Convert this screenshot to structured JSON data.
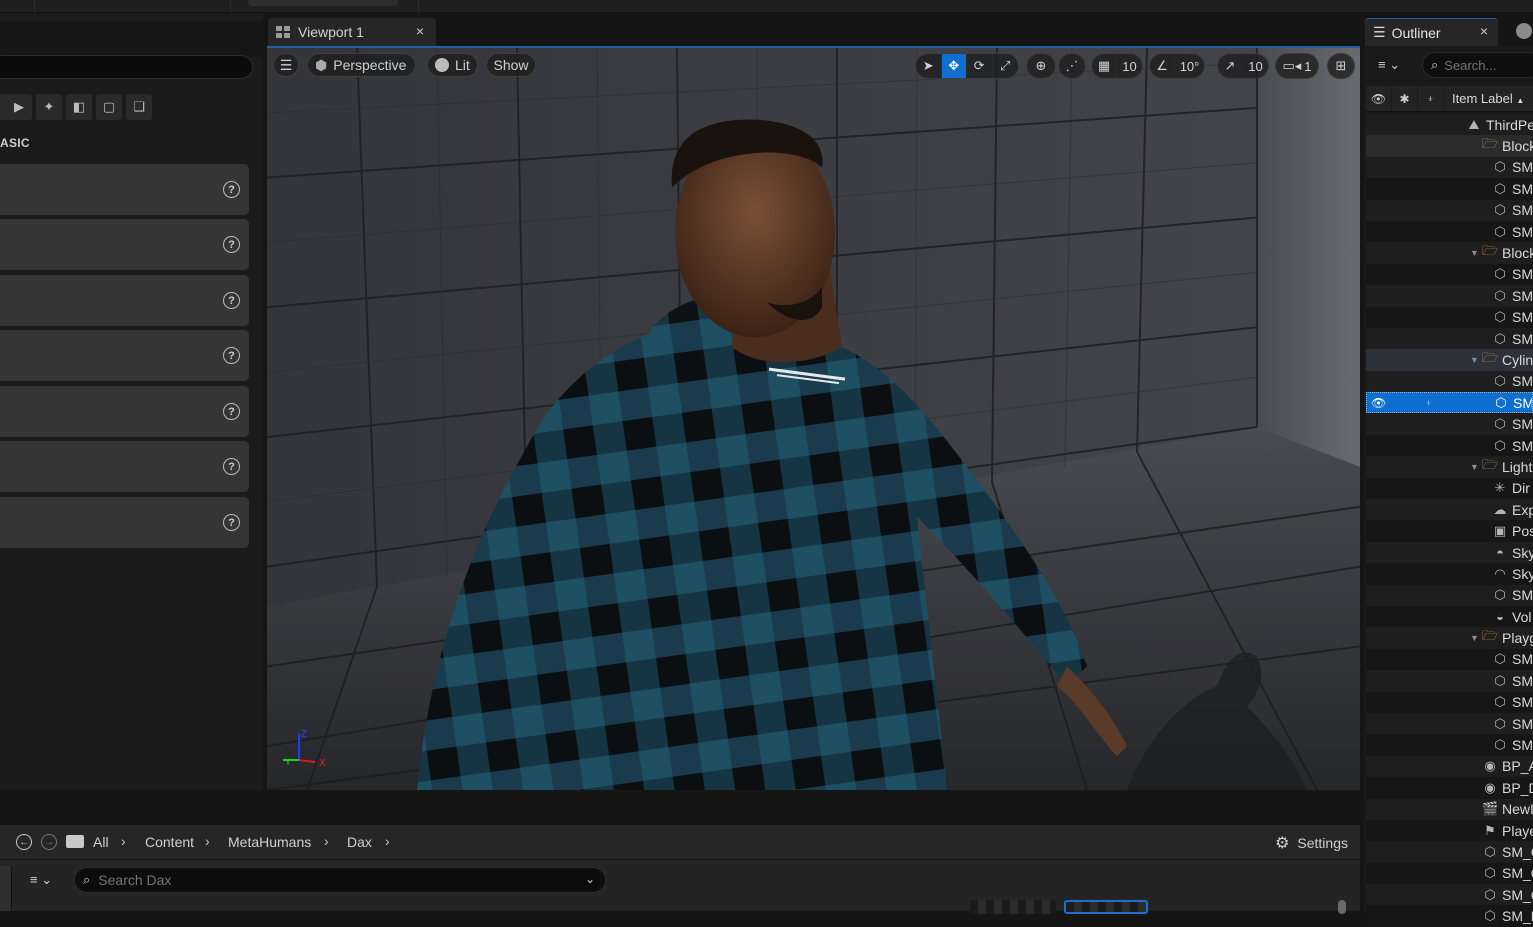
{
  "viewport_tab": {
    "label": "Viewport 1",
    "close": "×"
  },
  "viewport_toolbar": {
    "menu_icon": "hamburger-icon",
    "perspective_label": "Perspective",
    "lit_label": "Lit",
    "show_label": "Show",
    "tools": [
      "select",
      "translate",
      "rotate",
      "scale"
    ],
    "active_tool": "translate",
    "grid_snap_value": "10",
    "rotation_snap_value": "10°",
    "scale_snap_value": "10",
    "camera_speed_value": "1"
  },
  "left_panel": {
    "category_label": "ASIC",
    "place_items_count": 7,
    "mode_icons": [
      "play-icon",
      "sparkle-icon",
      "shapes-icon",
      "square-icon",
      "stack-icon"
    ]
  },
  "axis_gizmo": {
    "x": "X",
    "y": "Y",
    "z": "Z"
  },
  "outliner": {
    "tab_label": "Outliner",
    "close": "×",
    "search_placeholder": "Search...",
    "column_label": "Item Label",
    "sort_indicator": "▲",
    "rows": [
      {
        "label": "ThirdPe",
        "icon": "level-icon",
        "indent": 1
      },
      {
        "label": "Block",
        "icon": "folder-icon",
        "indent": 2,
        "folder": true
      },
      {
        "label": "SM",
        "icon": "mesh-icon",
        "indent": 3
      },
      {
        "label": "SM",
        "icon": "mesh-icon",
        "indent": 3
      },
      {
        "label": "SM",
        "icon": "mesh-icon",
        "indent": 3
      },
      {
        "label": "SM",
        "icon": "mesh-icon",
        "indent": 3
      },
      {
        "label": "Block",
        "icon": "folder-icon",
        "indent": 2,
        "folder": true,
        "expanded": true
      },
      {
        "label": "SM",
        "icon": "mesh-icon",
        "indent": 3
      },
      {
        "label": "SM",
        "icon": "mesh-icon",
        "indent": 3
      },
      {
        "label": "SM",
        "icon": "mesh-icon",
        "indent": 3
      },
      {
        "label": "SM",
        "icon": "mesh-icon",
        "indent": 3
      },
      {
        "label": "Cylin",
        "icon": "folder-icon",
        "indent": 2,
        "folder": true,
        "expanded": true,
        "hover": true
      },
      {
        "label": "SM",
        "icon": "mesh-icon",
        "indent": 3
      },
      {
        "label": "SM",
        "icon": "mesh-icon",
        "indent": 3,
        "selected": true
      },
      {
        "label": "SM",
        "icon": "mesh-icon",
        "indent": 3
      },
      {
        "label": "SM",
        "icon": "mesh-icon",
        "indent": 3
      },
      {
        "label": "Light",
        "icon": "folder-icon",
        "indent": 2,
        "folder": true,
        "expanded": true
      },
      {
        "label": "Dir",
        "icon": "directional-light-icon",
        "indent": 3
      },
      {
        "label": "Exp",
        "icon": "fog-icon",
        "indent": 3
      },
      {
        "label": "Pos",
        "icon": "post-process-icon",
        "indent": 3
      },
      {
        "label": "Sky",
        "icon": "sky-atmosphere-icon",
        "indent": 3
      },
      {
        "label": "Sky",
        "icon": "sky-light-icon",
        "indent": 3
      },
      {
        "label": "SM",
        "icon": "mesh-icon",
        "indent": 3
      },
      {
        "label": "Vol",
        "icon": "volumetric-cloud-icon",
        "indent": 3
      },
      {
        "label": "Playg",
        "icon": "folder-icon",
        "indent": 2,
        "folder": true,
        "expanded": true
      },
      {
        "label": "SM",
        "icon": "mesh-icon",
        "indent": 3
      },
      {
        "label": "SM",
        "icon": "mesh-icon",
        "indent": 3
      },
      {
        "label": "SM",
        "icon": "mesh-icon",
        "indent": 3
      },
      {
        "label": "SM",
        "icon": "mesh-icon",
        "indent": 3
      },
      {
        "label": "SM",
        "icon": "mesh-icon",
        "indent": 3
      },
      {
        "label": "BP_A",
        "icon": "blueprint-actor-icon",
        "indent": 2
      },
      {
        "label": "BP_D",
        "icon": "blueprint-actor-icon",
        "indent": 2
      },
      {
        "label": "NewI",
        "icon": "level-sequence-icon",
        "indent": 2
      },
      {
        "label": "Playe",
        "icon": "player-start-icon",
        "indent": 2
      },
      {
        "label": "SM_C",
        "icon": "mesh-icon",
        "indent": 2
      },
      {
        "label": "SM_C",
        "icon": "mesh-icon",
        "indent": 2
      },
      {
        "label": "SM_C",
        "icon": "mesh-icon",
        "indent": 2
      },
      {
        "label": "SM_F",
        "icon": "mesh-icon",
        "indent": 2
      }
    ]
  },
  "content_browser": {
    "breadcrumbs": [
      "All",
      "Content",
      "MetaHumans",
      "Dax"
    ],
    "settings_label": "Settings",
    "search_placeholder": "Search Dax"
  },
  "colors": {
    "accent": "#0e6fd1",
    "folder": "#c79a57",
    "panel": "#1b1b1b",
    "place_item": "#353535"
  }
}
